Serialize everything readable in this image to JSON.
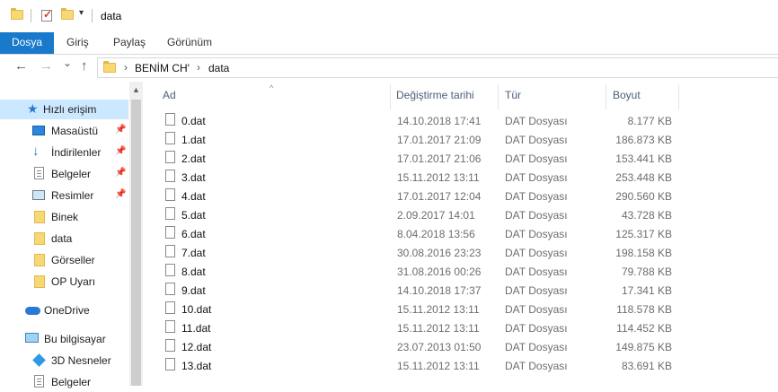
{
  "window": {
    "title": "data"
  },
  "quick_access_toolbar": {
    "icons": [
      "folder-icon",
      "properties-icon",
      "new-folder-icon",
      "customize-dropdown-icon"
    ],
    "dropdown_glyph": "▾"
  },
  "ribbon": {
    "tabs": [
      {
        "label": "Dosya",
        "active": true
      },
      {
        "label": "Giriş"
      },
      {
        "label": "Paylaş"
      },
      {
        "label": "Görünüm"
      }
    ]
  },
  "navigation": {
    "back": "←",
    "forward": "→",
    "recent": "⌄",
    "up": "↑",
    "breadcrumb": [
      "BENİM CH'",
      "data"
    ],
    "breadcrumb_sep": "›"
  },
  "nav_pane": {
    "items": [
      {
        "label": "Hızlı erişim",
        "icon": "star-icon",
        "selected": true
      },
      {
        "label": "Masaüstü",
        "icon": "desktop-icon",
        "pinned": true
      },
      {
        "label": "İndirilenler",
        "icon": "download-icon",
        "pinned": true
      },
      {
        "label": "Belgeler",
        "icon": "documents-icon",
        "pinned": true
      },
      {
        "label": "Resimler",
        "icon": "pictures-icon",
        "pinned": true
      },
      {
        "label": "Binek",
        "icon": "folder-icon"
      },
      {
        "label": "data",
        "icon": "folder-icon"
      },
      {
        "label": "Görseller",
        "icon": "folder-icon"
      },
      {
        "label": "OP Uyarı",
        "icon": "folder-icon"
      },
      {
        "label": "OneDrive",
        "icon": "onedrive-icon"
      },
      {
        "label": "Bu bilgisayar",
        "icon": "computer-icon"
      },
      {
        "label": "3D Nesneler",
        "icon": "3d-objects-icon"
      },
      {
        "label": "Belgeler",
        "icon": "documents-icon"
      }
    ],
    "pin_glyph": "📌"
  },
  "file_list": {
    "columns": [
      "Ad",
      "Değiştirme tarihi",
      "Tür",
      "Boyut"
    ],
    "sort_glyph": "^",
    "rows": [
      {
        "name": "0.dat",
        "modified": "14.10.2018 17:41",
        "type": "DAT Dosyası",
        "size": "8.177 KB"
      },
      {
        "name": "1.dat",
        "modified": "17.01.2017 21:09",
        "type": "DAT Dosyası",
        "size": "186.873 KB"
      },
      {
        "name": "2.dat",
        "modified": "17.01.2017 21:06",
        "type": "DAT Dosyası",
        "size": "153.441 KB"
      },
      {
        "name": "3.dat",
        "modified": "15.11.2012 13:11",
        "type": "DAT Dosyası",
        "size": "253.448 KB"
      },
      {
        "name": "4.dat",
        "modified": "17.01.2017 12:04",
        "type": "DAT Dosyası",
        "size": "290.560 KB"
      },
      {
        "name": "5.dat",
        "modified": "2.09.2017 14:01",
        "type": "DAT Dosyası",
        "size": "43.728 KB"
      },
      {
        "name": "6.dat",
        "modified": "8.04.2018 13:56",
        "type": "DAT Dosyası",
        "size": "125.317 KB"
      },
      {
        "name": "7.dat",
        "modified": "30.08.2016 23:23",
        "type": "DAT Dosyası",
        "size": "198.158 KB"
      },
      {
        "name": "8.dat",
        "modified": "31.08.2016 00:26",
        "type": "DAT Dosyası",
        "size": "79.788 KB"
      },
      {
        "name": "9.dat",
        "modified": "14.10.2018 17:37",
        "type": "DAT Dosyası",
        "size": "17.341 KB"
      },
      {
        "name": "10.dat",
        "modified": "15.11.2012 13:11",
        "type": "DAT Dosyası",
        "size": "118.578 KB"
      },
      {
        "name": "11.dat",
        "modified": "15.11.2012 13:11",
        "type": "DAT Dosyası",
        "size": "114.452 KB"
      },
      {
        "name": "12.dat",
        "modified": "23.07.2013 01:50",
        "type": "DAT Dosyası",
        "size": "149.875 KB"
      },
      {
        "name": "13.dat",
        "modified": "15.11.2012 13:11",
        "type": "DAT Dosyası",
        "size": "83.691 KB"
      }
    ]
  },
  "colors": {
    "accent": "#1979ca",
    "selection": "#cce8ff",
    "header_text": "#4c607a"
  }
}
